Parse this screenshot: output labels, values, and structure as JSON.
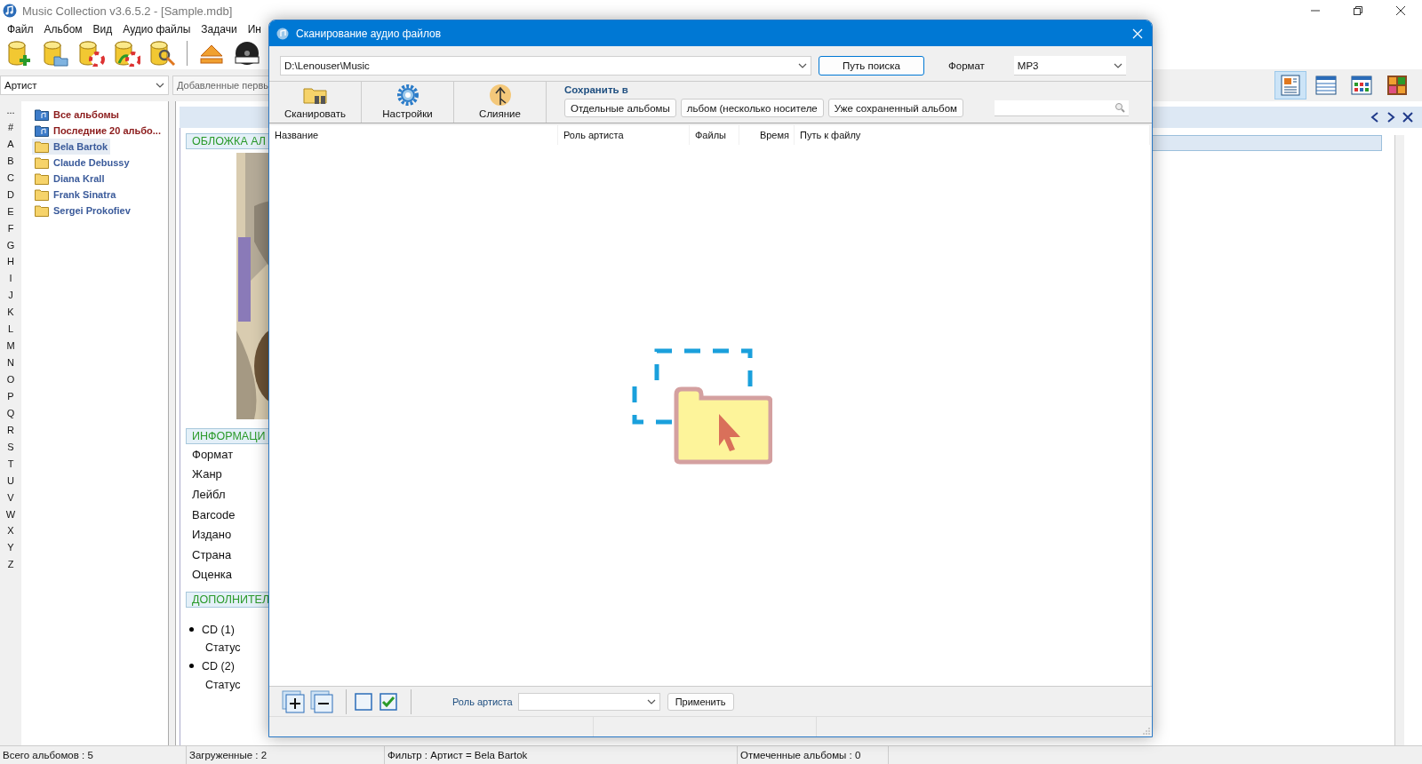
{
  "window": {
    "title": "Music Collection v3.6.5.2 - [Sample.mdb]"
  },
  "menu": [
    "Файл",
    "Альбом",
    "Вид",
    "Аудио файлы",
    "Задачи",
    "Ин"
  ],
  "filter": {
    "field": "Артист",
    "sort": "Добавленные первы"
  },
  "view_buttons": [
    {
      "selected": true
    },
    {
      "selected": false
    },
    {
      "selected": false
    },
    {
      "selected": false
    }
  ],
  "alphabet": [
    "...",
    "#",
    "A",
    "B",
    "C",
    "D",
    "E",
    "F",
    "G",
    "H",
    "I",
    "J",
    "K",
    "L",
    "M",
    "N",
    "O",
    "P",
    "Q",
    "R",
    "S",
    "T",
    "U",
    "V",
    "W",
    "X",
    "Y",
    "Z"
  ],
  "tree": [
    {
      "label": "Все альбомы",
      "kind": "library",
      "selected": false
    },
    {
      "label": "Последние 20 альбо...",
      "kind": "library",
      "selected": false
    },
    {
      "label": "Bela Bartok",
      "kind": "folder",
      "selected": true
    },
    {
      "label": "Claude Debussy",
      "kind": "folder",
      "selected": false
    },
    {
      "label": "Diana Krall",
      "kind": "folder",
      "selected": false
    },
    {
      "label": "Frank Sinatra",
      "kind": "folder",
      "selected": false
    },
    {
      "label": "Sergei Prokofiev",
      "kind": "folder",
      "selected": false
    }
  ],
  "album": {
    "cover_title": "ОБЛОЖКА АЛ",
    "info_title": "ИНФОРМАЦИ",
    "info_fields": [
      "Формат",
      "Жанр",
      "Лейбл",
      "Barcode",
      "Издано",
      "Страна",
      "Оценка"
    ],
    "extra_title": "ДОПОЛНИТЕЛ",
    "media": [
      {
        "name": "CD (1)",
        "status": "Статус"
      },
      {
        "name": "CD (2)",
        "status": "Статус"
      }
    ]
  },
  "status_bar": [
    "Всего альбомов : 5",
    "Загруженные : 2",
    "Фильтр : Артист = Bela Bartok",
    "Отмеченные альбомы : 0"
  ],
  "dialog": {
    "title": "Сканирование аудио файлов",
    "path": "D:\\Lenouser\\Music",
    "search_path_button": "Путь поиска",
    "format_label": "Формат",
    "format": "MP3",
    "tools": [
      {
        "label": "Сканировать",
        "kind": "scan"
      },
      {
        "label": "Настройки",
        "kind": "settings"
      },
      {
        "label": "Слияние",
        "kind": "merge"
      }
    ],
    "save_to_label": "Сохранить в",
    "save_buttons": [
      "Отдельные альбомы",
      "льбом (несколько носителе",
      "Уже сохраненный альбом"
    ],
    "columns": [
      "Название",
      "Роль артиста",
      "Файлы",
      "Время",
      "Путь к файлу"
    ],
    "role_label": "Роль артиста",
    "apply_button": "Применить"
  }
}
